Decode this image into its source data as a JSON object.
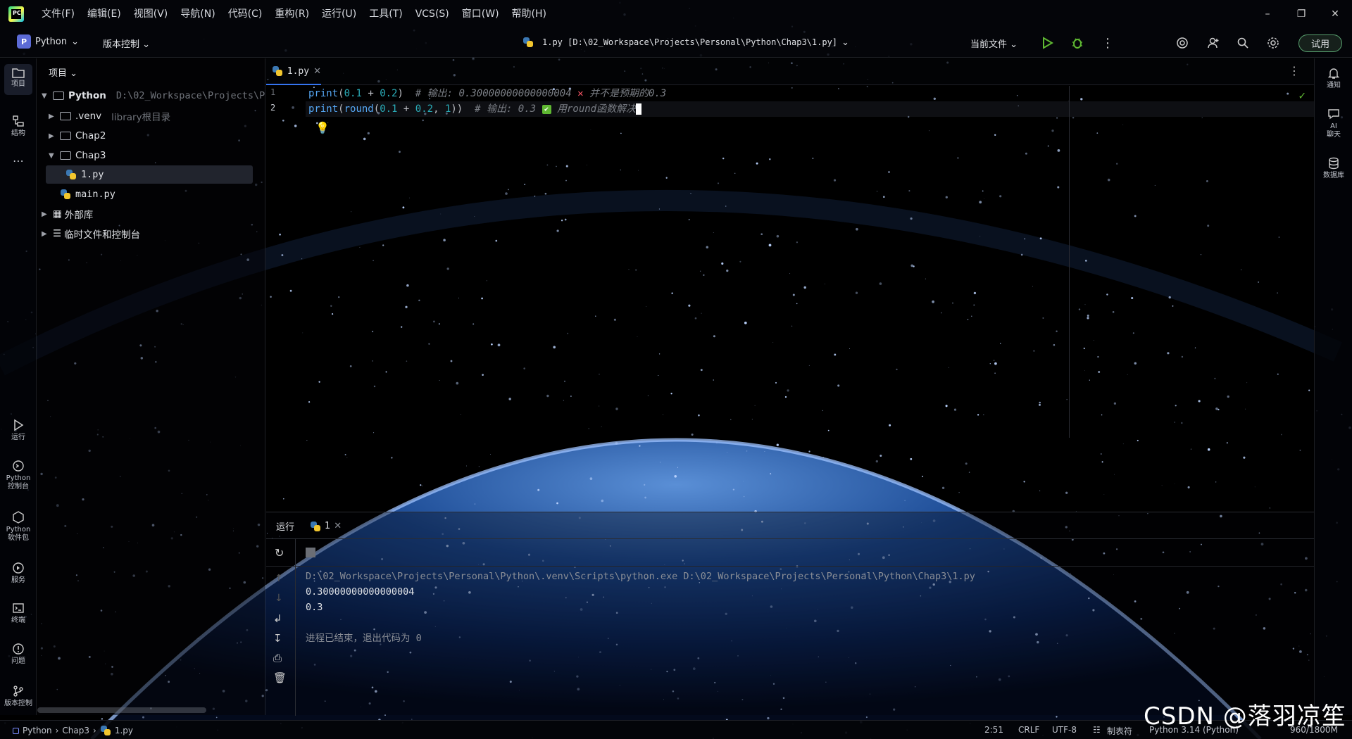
{
  "app": {
    "logo_text": "PC"
  },
  "menu": [
    "文件(F)",
    "编辑(E)",
    "视图(V)",
    "导航(N)",
    "代码(C)",
    "重构(R)",
    "运行(U)",
    "工具(T)",
    "VCS(S)",
    "窗口(W)",
    "帮助(H)"
  ],
  "toolbar": {
    "project_badge": "P",
    "project_name": "Python",
    "vcs_label": "版本控制",
    "file_label": "1.py [D:\\02_Workspace\\Projects\\Personal\\Python\\Chap3\\1.py]",
    "run_config": "当前文件",
    "trial_label": "试用"
  },
  "left_strip": {
    "project": "项目",
    "structure": "结构",
    "run": "运行",
    "python_console": "Python\n控制台",
    "python_packages": "Python\n软件包",
    "services": "服务",
    "terminal": "终端",
    "problems": "问题",
    "vcs": "版本控制"
  },
  "right_strip": {
    "notifications": "通知",
    "ai_chat": "AI\n聊天",
    "database": "数据库"
  },
  "project_panel": {
    "header": "项目",
    "tree": [
      {
        "label": "Python",
        "hint": "D:\\02_Workspace\\Projects\\Pe"
      },
      {
        "label": ".venv",
        "hint": "library根目录"
      },
      {
        "label": "Chap2",
        "hint": ""
      },
      {
        "label": "Chap3",
        "hint": ""
      },
      {
        "label": "1.py",
        "hint": ""
      },
      {
        "label": "main.py",
        "hint": ""
      },
      {
        "label": "外部库",
        "hint": ""
      },
      {
        "label": "临时文件和控制台",
        "hint": ""
      }
    ]
  },
  "editor": {
    "tab": "1.py",
    "line_numbers": [
      "1",
      "2"
    ],
    "line1": {
      "fn": "print",
      "p1": "(",
      "n1": "0.1",
      "op": " + ",
      "n2": "0.2",
      "p2": ")",
      "comment": "  # 输出: 0.30000000000000004 ",
      "mark": "✕",
      "comment2": " 并不是预期的0.3"
    },
    "line2": {
      "fn": "print",
      "p1": "(",
      "fn2": "round",
      "p2": "(",
      "n1": "0.1",
      "op": " + ",
      "n2": "0.2",
      "sep": ", ",
      "n3": "1",
      "p3": "))",
      "comment": "  # 输出: 0.3 ",
      "mark": "✔",
      "comment2": " 用round函数解决"
    }
  },
  "run_panel": {
    "title": "运行",
    "tab": "1",
    "cmd": "D:\\02_Workspace\\Projects\\Personal\\Python\\.venv\\Scripts\\python.exe D:\\02_Workspace\\Projects\\Personal\\Python\\Chap3\\1.py",
    "out1": "0.30000000000000004",
    "out2": "0.3",
    "exit": "进程已结束，退出代码为 0"
  },
  "status": {
    "crumb1": "Python",
    "crumb2": "Chap3",
    "crumb3": "1.py",
    "position": "2:51",
    "line_sep": "CRLF",
    "encoding": "UTF-8",
    "indent": "制表符",
    "interpreter": "Python 3.14 (Python)",
    "memory": "960/1800M"
  },
  "watermark": "CSDN @落羽凉笙",
  "colors": {
    "accent": "#3574f0",
    "keyword": "#56a8f5",
    "number": "#2aacb8",
    "comment": "#7a7e85",
    "run_green": "#5fb832",
    "error_red": "#f75464"
  }
}
